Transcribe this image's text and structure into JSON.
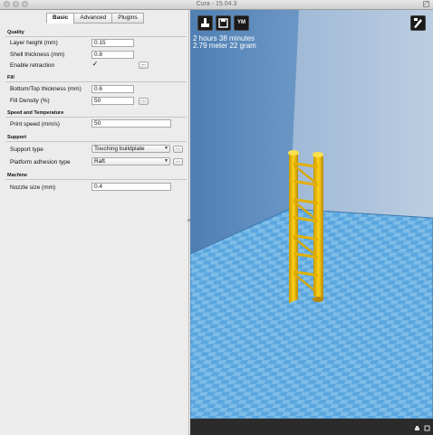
{
  "window": {
    "title": "Cura - 15.04.3"
  },
  "tabs": [
    {
      "label": "Basic",
      "active": true
    },
    {
      "label": "Advanced",
      "active": false
    },
    {
      "label": "Plugins",
      "active": false
    }
  ],
  "quality": {
    "heading": "Quality",
    "layer_height": {
      "label": "Layer height (mm)",
      "value": "0.15"
    },
    "shell_thickness": {
      "label": "Shell thickness (mm)",
      "value": "0.8"
    },
    "retraction": {
      "label": "Enable retraction",
      "checked": true,
      "check_glyph": "✓",
      "button": "..."
    }
  },
  "fill": {
    "heading": "Fill",
    "bottom_top": {
      "label": "Bottom/Top thickness (mm)",
      "value": "0.6"
    },
    "density": {
      "label": "Fill Density (%)",
      "value": "50",
      "button": "..."
    }
  },
  "speed": {
    "heading": "Speed and Temperature",
    "print_speed": {
      "label": "Print speed (mm/s)",
      "value": "50"
    }
  },
  "support": {
    "heading": "Support",
    "support_type": {
      "label": "Support type",
      "value": "Touching buildplate",
      "button": "..."
    },
    "adhesion": {
      "label": "Platform adhesion type",
      "value": "Raft",
      "button": "..."
    }
  },
  "machine": {
    "heading": "Machine",
    "nozzle": {
      "label": "Nozzle size (mm)",
      "value": "0.4"
    }
  },
  "viewport": {
    "button_ym": "YM",
    "time_line": "2 hours 38 minutes",
    "material_line": "2.79 meter 22 gram",
    "colors": {
      "model": "#f2c400",
      "plate_a": "#5aa6de",
      "plate_b": "#7dbde8"
    }
  }
}
